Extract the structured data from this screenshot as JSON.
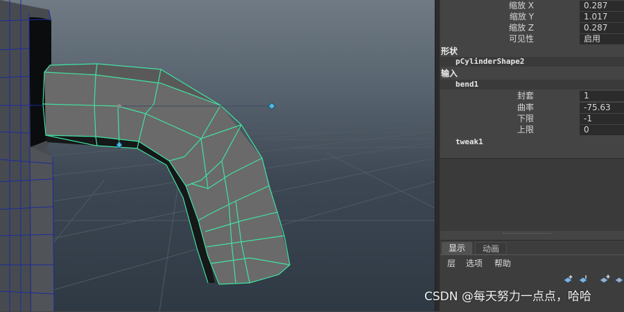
{
  "attributes": {
    "scale_x": {
      "label": "缩放 X",
      "value": "0.287"
    },
    "scale_y": {
      "label": "缩放 Y",
      "value": "1.017"
    },
    "scale_z": {
      "label": "缩放 Z",
      "value": "0.287"
    },
    "visibility": {
      "label": "可见性",
      "value": "启用"
    }
  },
  "shapes": {
    "header": "形状",
    "node": "pCylinderShape2"
  },
  "inputs": {
    "header": "输入",
    "bend_node": "bend1",
    "bend_attrs": [
      {
        "label": "封套",
        "value": "1"
      },
      {
        "label": "曲率",
        "value": "-75.63"
      },
      {
        "label": "下限",
        "value": "-1"
      },
      {
        "label": "上限",
        "value": "0"
      }
    ],
    "tweak_node": "tweak1"
  },
  "layer_editor": {
    "tabs": [
      "显示",
      "动画"
    ],
    "menu": [
      "层",
      "选项",
      "帮助"
    ],
    "buttons": [
      "new-layer-icon",
      "new-layer-selected-icon",
      "move-up-icon",
      "move-down-icon"
    ]
  },
  "watermark": "CSDN @每天努力一点点，哈哈",
  "colors": {
    "wireframe_selected": "#40e3a2",
    "wireframe_scene": "#1d2a9c",
    "manipulator": "#4fb6e4"
  }
}
